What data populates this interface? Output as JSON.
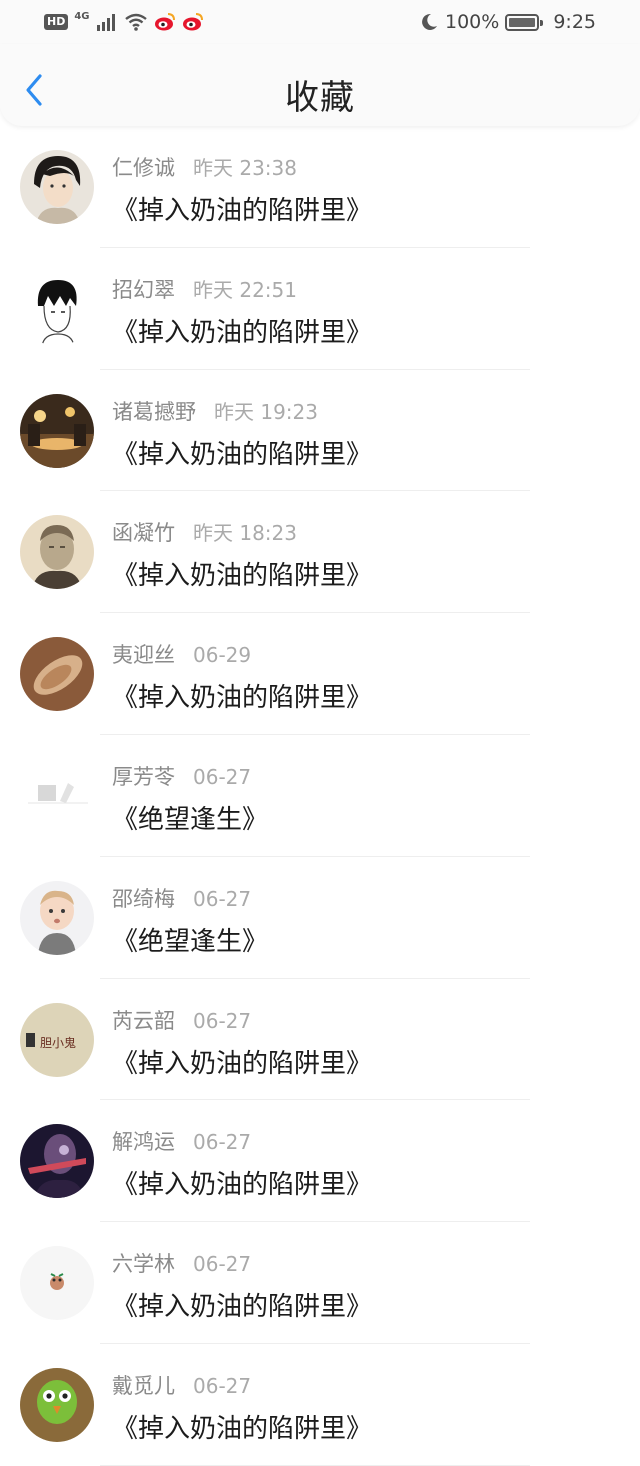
{
  "status_bar": {
    "hd": "HD",
    "network": "4G",
    "battery": "100%",
    "time": "9:25"
  },
  "header": {
    "title": "收藏",
    "back_icon": "chevron-left-icon"
  },
  "accent_color": "#2d8cf0",
  "items": [
    {
      "name": "仁修诚",
      "time": "昨天 23:38",
      "title": "《掉入奶油的陷阱里》"
    },
    {
      "name": "招幻翠",
      "time": "昨天 22:51",
      "title": "《掉入奶油的陷阱里》"
    },
    {
      "name": "诸葛撼野",
      "time": "昨天 19:23",
      "title": "《掉入奶油的陷阱里》"
    },
    {
      "name": "函凝竹",
      "time": "昨天 18:23",
      "title": "《掉入奶油的陷阱里》"
    },
    {
      "name": "夷迎丝",
      "time": "06-29",
      "title": "《掉入奶油的陷阱里》"
    },
    {
      "name": "厚芳苓",
      "time": "06-27",
      "title": "《绝望逢生》"
    },
    {
      "name": "邵绮梅",
      "time": "06-27",
      "title": "《绝望逢生》"
    },
    {
      "name": "芮云韶",
      "time": "06-27",
      "title": "《掉入奶油的陷阱里》",
      "avatar_text": "胆小鬼"
    },
    {
      "name": "解鸿运",
      "time": "06-27",
      "title": "《掉入奶油的陷阱里》"
    },
    {
      "name": "六学林",
      "time": "06-27",
      "title": "《掉入奶油的陷阱里》"
    },
    {
      "name": "戴觅儿",
      "time": "06-27",
      "title": "《掉入奶油的陷阱里》"
    }
  ]
}
